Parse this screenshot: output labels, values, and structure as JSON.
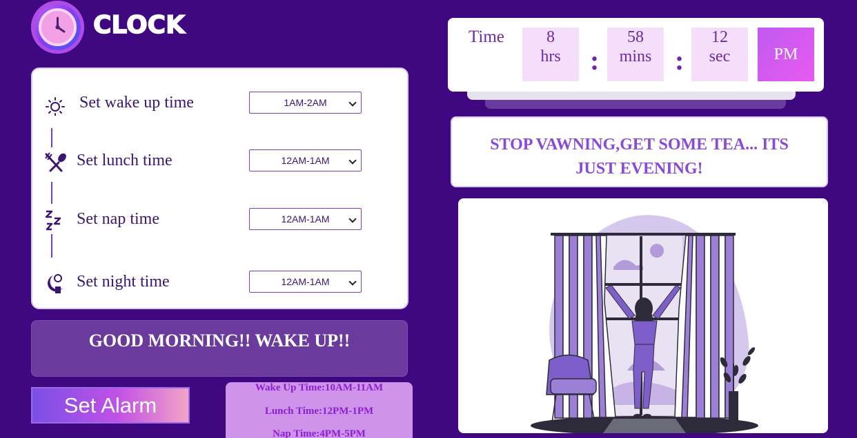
{
  "app": {
    "title": "CLOCK"
  },
  "settings": {
    "rows": [
      {
        "label": "Set wake up time",
        "value": "1AM-2AM",
        "icon": "sun-icon"
      },
      {
        "label": "Set lunch time",
        "value": "12AM-1AM",
        "icon": "utensils-icon"
      },
      {
        "label": "Set nap time",
        "value": "12AM-1AM",
        "icon": "zzz-icon"
      },
      {
        "label": "Set night time",
        "value": "12AM-1AM",
        "icon": "moon-icon"
      }
    ]
  },
  "greeting": "GOOD MORNING!! WAKE UP!!",
  "set_alarm_label": "Set Alarm",
  "schedule": {
    "wake": "Wake Up Time:10AM-11AM",
    "lunch": "Lunch Time:12PM-1PM",
    "nap": "Nap Time:4PM-5PM"
  },
  "time": {
    "label": "Time",
    "hours": "8",
    "hours_unit": "hrs",
    "minutes": "58",
    "minutes_unit": "mins",
    "seconds": "12",
    "seconds_unit": "sec",
    "separator": ":",
    "ampm": "PM"
  },
  "message": "STOP VAWNING,GET SOME TEA... ITS JUST EVENING!",
  "colors": {
    "background": "#3f0780",
    "accent": "#c05af0",
    "text_purple": "#6a2aa8",
    "greeting_bg": "#6a3a9c"
  }
}
